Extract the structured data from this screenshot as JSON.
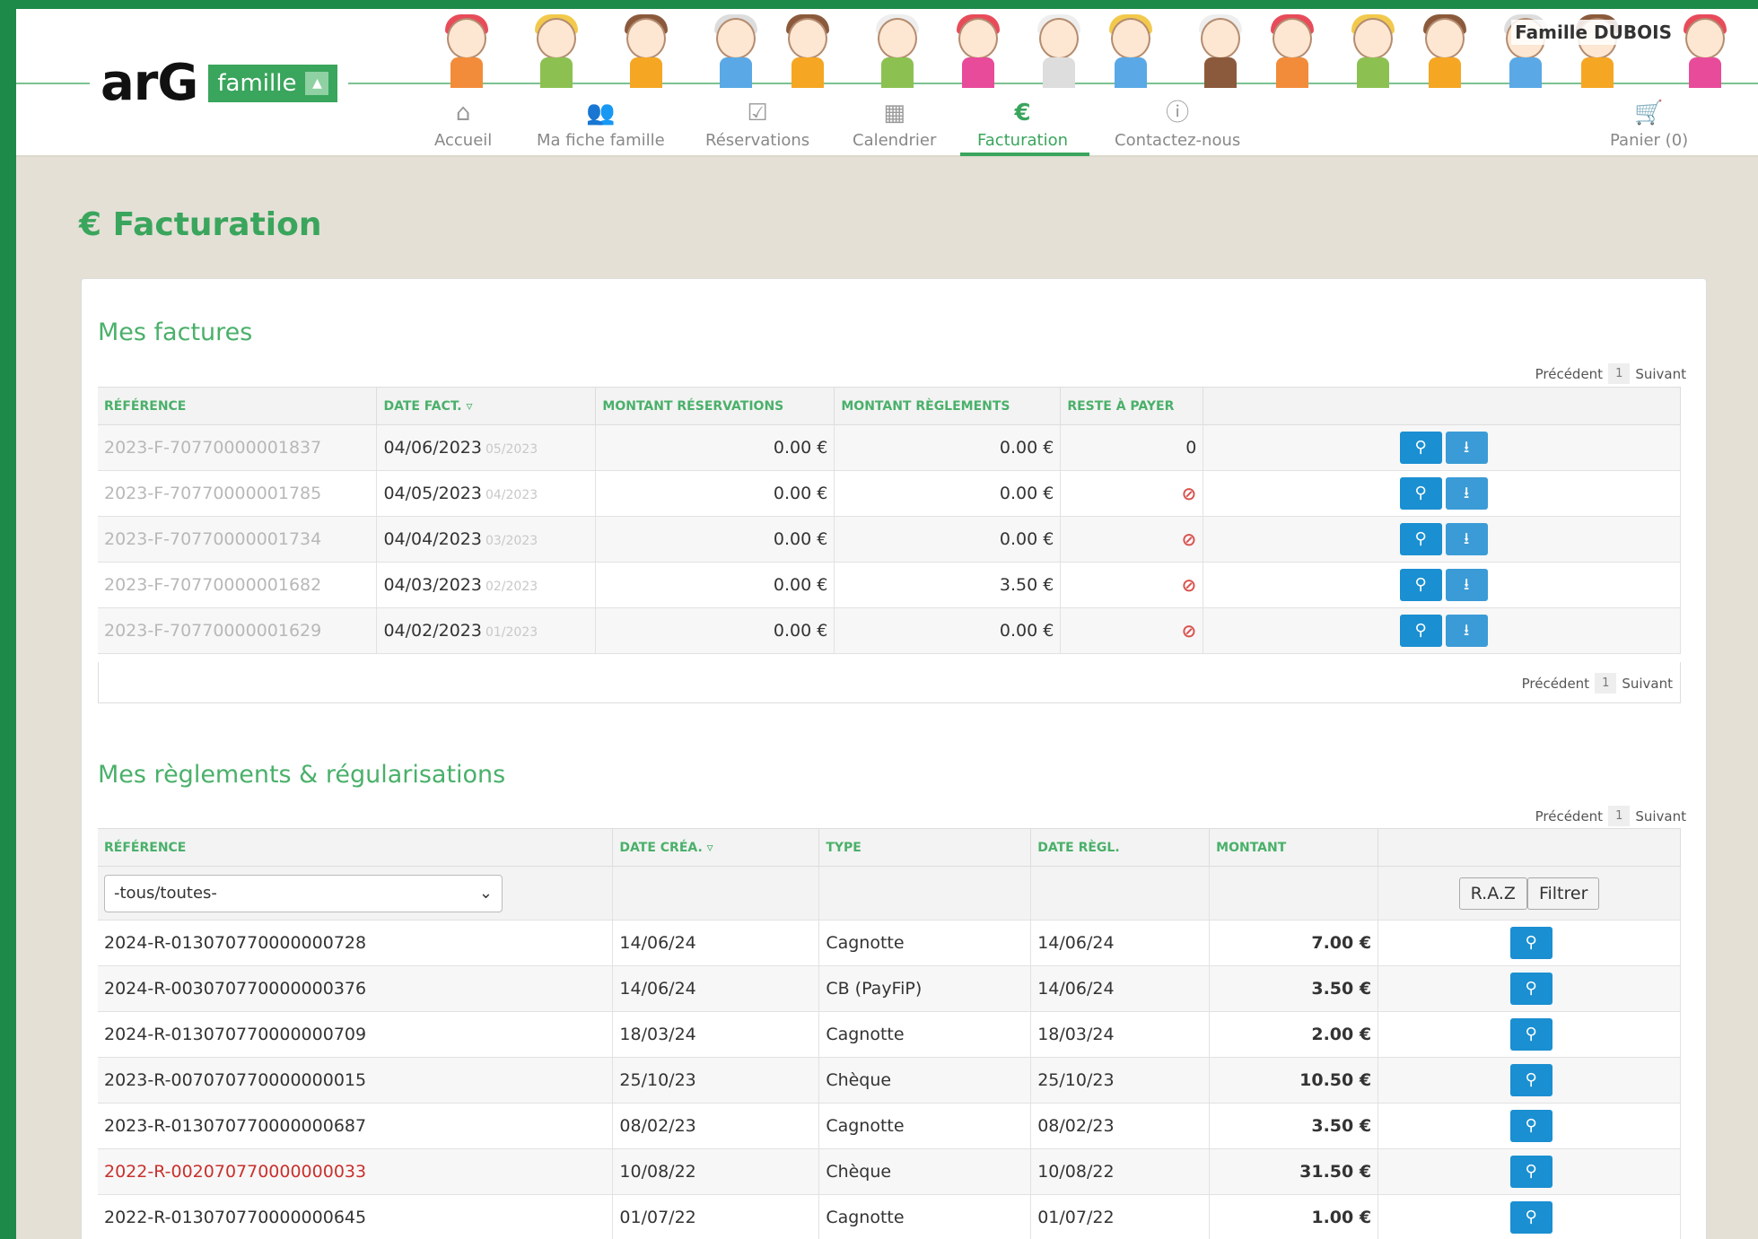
{
  "header": {
    "logo_text": "arG",
    "logo_badge": "famille",
    "family_name": "Famille DUBOIS",
    "nav": [
      {
        "icon": "home-icon",
        "glyph": "⌂",
        "label": "Accueil"
      },
      {
        "icon": "users-icon",
        "glyph": "👥",
        "label": "Ma fiche famille"
      },
      {
        "icon": "calendar-check-icon",
        "glyph": "☑",
        "label": "Réservations"
      },
      {
        "icon": "calendar-icon",
        "glyph": "▦",
        "label": "Calendrier"
      },
      {
        "icon": "euro-icon",
        "glyph": "€",
        "label": "Facturation"
      },
      {
        "icon": "info-icon",
        "glyph": "ⓘ",
        "label": "Contactez-nous"
      }
    ],
    "cart": {
      "icon": "cart-icon",
      "glyph": "🛒",
      "label": "Panier (0)"
    },
    "active_nav": "Facturation"
  },
  "page": {
    "title": "€ Facturation"
  },
  "invoices": {
    "title": "Mes factures",
    "pager": {
      "prev": "Précédent",
      "page": "1",
      "next": "Suivant"
    },
    "columns": [
      "RÉFÉRENCE",
      "DATE FACT. ▿",
      "MONTANT RÉSERVATIONS",
      "MONTANT RÈGLEMENTS",
      "RESTE À PAYER"
    ],
    "rows": [
      {
        "ref": "2023-F-70770000001837",
        "date": "04/06/2023",
        "period": "05/2023",
        "reservations": "0.00 €",
        "reglements": "0.00 €",
        "reste": "0"
      },
      {
        "ref": "2023-F-70770000001785",
        "date": "04/05/2023",
        "period": "04/2023",
        "reservations": "0.00 €",
        "reglements": "0.00 €",
        "reste": "⊘"
      },
      {
        "ref": "2023-F-70770000001734",
        "date": "04/04/2023",
        "period": "03/2023",
        "reservations": "0.00 €",
        "reglements": "0.00 €",
        "reste": "⊘"
      },
      {
        "ref": "2023-F-70770000001682",
        "date": "04/03/2023",
        "period": "02/2023",
        "reservations": "0.00 €",
        "reglements": "3.50 €",
        "reste": "⊘"
      },
      {
        "ref": "2023-F-70770000001629",
        "date": "04/02/2023",
        "period": "01/2023",
        "reservations": "0.00 €",
        "reglements": "0.00 €",
        "reste": "⊘"
      }
    ]
  },
  "payments": {
    "title": "Mes règlements & régularisations",
    "pager": {
      "prev": "Précédent",
      "page": "1",
      "next": "Suivant"
    },
    "columns": [
      "RÉFÉRENCE",
      "DATE CRÉA. ▿",
      "TYPE",
      "DATE RÈGL.",
      "MONTANT"
    ],
    "filter_value": "-tous/toutes-",
    "raz_label": "R.A.Z",
    "filter_label": "Filtrer",
    "rows": [
      {
        "ref": "2024-R-013070770000000728",
        "date_crea": "14/06/24",
        "type": "Cagnotte",
        "date_regl": "14/06/24",
        "montant": "7.00 €",
        "highlight": false
      },
      {
        "ref": "2024-R-003070770000000376",
        "date_crea": "14/06/24",
        "type": "CB (PayFiP)",
        "date_regl": "14/06/24",
        "montant": "3.50 €",
        "highlight": false
      },
      {
        "ref": "2024-R-013070770000000709",
        "date_crea": "18/03/24",
        "type": "Cagnotte",
        "date_regl": "18/03/24",
        "montant": "2.00 €",
        "highlight": false
      },
      {
        "ref": "2023-R-007070770000000015",
        "date_crea": "25/10/23",
        "type": "Chèque",
        "date_regl": "25/10/23",
        "montant": "10.50 €",
        "highlight": false
      },
      {
        "ref": "2023-R-013070770000000687",
        "date_crea": "08/02/23",
        "type": "Cagnotte",
        "date_regl": "08/02/23",
        "montant": "3.50 €",
        "highlight": false
      },
      {
        "ref": "2022-R-002070770000000033",
        "date_crea": "10/08/22",
        "type": "Chèque",
        "date_regl": "10/08/22",
        "montant": "31.50 €",
        "highlight": true
      },
      {
        "ref": "2022-R-013070770000000645",
        "date_crea": "01/07/22",
        "type": "Cagnotte",
        "date_regl": "01/07/22",
        "montant": "1.00 €",
        "highlight": false
      }
    ]
  },
  "colors": {
    "brand_green": "#3aa55c",
    "button_blue": "#1a8fd1",
    "alert_red": "#c9302c"
  }
}
